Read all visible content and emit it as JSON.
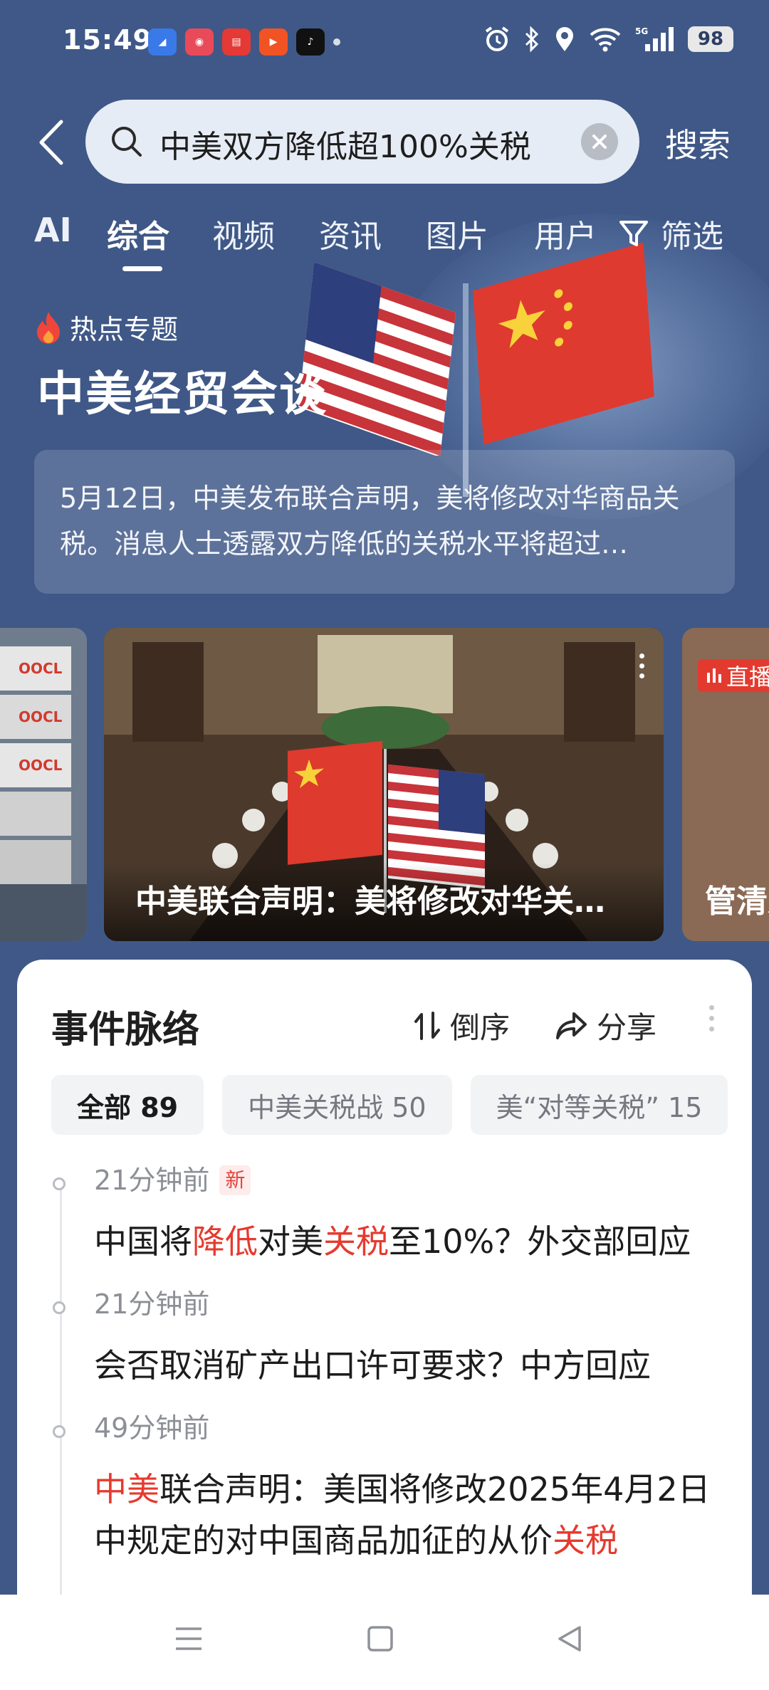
{
  "status_bar": {
    "time": "15:49",
    "battery": "98",
    "network": "5G"
  },
  "search": {
    "query": "中美双方降低超100%关税",
    "button_label": "搜索"
  },
  "tabs": {
    "ai": "AI",
    "items": [
      "综合",
      "视频",
      "资讯",
      "图片",
      "用户"
    ],
    "active": "综合",
    "filter_label": "筛选"
  },
  "hot_topic": {
    "label": "热点专题",
    "title": "中美经贸会谈",
    "summary": "5月12日，中美发布联合声明，美将修改对华商品关税。消息人士透露双方降低的关税水平将超过…"
  },
  "cards": {
    "main_caption": "中美联合声明：美将修改对华关…",
    "right_badge": "直播",
    "right_caption": "管清友"
  },
  "timeline_panel": {
    "title": "事件脉络",
    "sort_label": "倒序",
    "share_label": "分享",
    "chips": [
      "全部 89",
      "中美关税战 50",
      "美“对等关税” 15"
    ],
    "new_badge": "新",
    "items": [
      {
        "time": "21分钟前",
        "parts": [
          {
            "t": "中国将",
            "h": false
          },
          {
            "t": "降低",
            "h": true
          },
          {
            "t": "对美",
            "h": false
          },
          {
            "t": "关税",
            "h": true
          },
          {
            "t": "至10%？外交部回应",
            "h": false
          }
        ]
      },
      {
        "time": "21分钟前",
        "parts": [
          {
            "t": "会否取消矿产出口许可要求？中方回应",
            "h": false
          }
        ]
      },
      {
        "time": "49分钟前",
        "parts": [
          {
            "t": "中美",
            "h": true
          },
          {
            "t": "联合声明：美国将修改2025年4月2日中规定的对中国商品加征的从价",
            "h": false
          },
          {
            "t": "关税",
            "h": true
          }
        ]
      }
    ]
  },
  "icons": {
    "back": "back-arrow-icon",
    "search": "search-icon",
    "clear": "clear-icon",
    "filter": "filter-icon",
    "fire": "fire-icon",
    "sort": "sort-icon",
    "share": "share-icon",
    "more": "more-vertical-icon"
  },
  "colors": {
    "background": "#3f5887",
    "highlight": "#e63a2e",
    "live": "#e33a2f"
  }
}
